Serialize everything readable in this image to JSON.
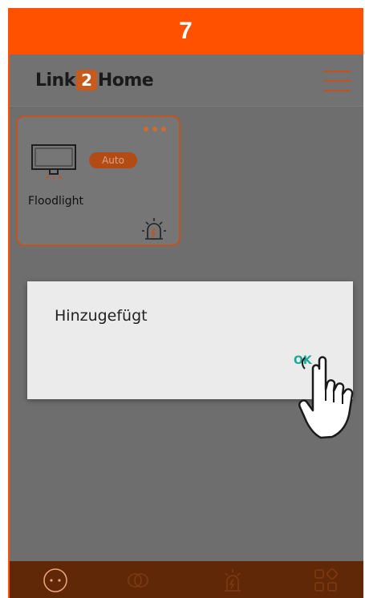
{
  "step": {
    "number": "7"
  },
  "header": {
    "logo": {
      "part1": "Link",
      "part2": "2",
      "part3": "Home"
    }
  },
  "device_card": {
    "name": "Floodlight",
    "mode_badge": "Auto"
  },
  "dialog": {
    "message": "Hinzugefügt",
    "ok_label": "OK"
  },
  "bottom_nav": {
    "items": [
      {
        "icon": "devices-icon",
        "active": true
      },
      {
        "icon": "link-icon",
        "active": false
      },
      {
        "icon": "alarm-icon",
        "active": false
      },
      {
        "icon": "apps-grid-icon",
        "active": false
      }
    ]
  },
  "colors": {
    "accent": "#ff5100",
    "card_border": "#c0541f",
    "ok_button": "#1aa89a",
    "overlay": "#6e6e6e",
    "nav_bg": "#612807"
  }
}
